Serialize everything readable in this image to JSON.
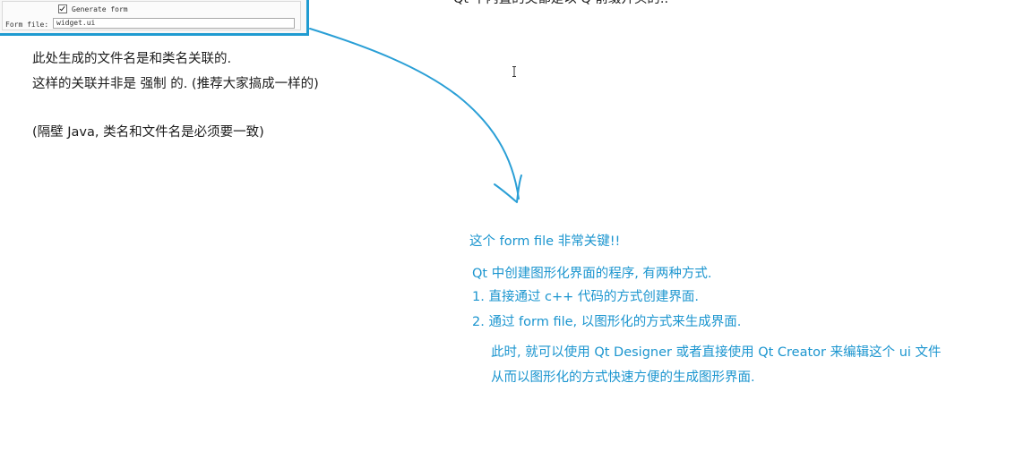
{
  "wizard": {
    "generate_form_label": "Generate form",
    "form_file_label": "Form file:",
    "form_file_value": "widget.ui"
  },
  "top_cut_text": "Qt 中内置的类都是以 Q 前缀开头的..",
  "notes_left": [
    "此处生成的文件名是和类名关联的.",
    "这样的关联并非是 强制 的. (推荐大家搞成一样的)",
    "(隔壁 Java, 类名和文件名是必须要一致)"
  ],
  "notes_blue": {
    "headline": "这个 form file 非常关键!!",
    "intro": "Qt 中创建图形化界面的程序, 有两种方式.",
    "item1": "1. 直接通过 c++ 代码的方式创建界面.",
    "item2": "2. 通过 form file, 以图形化的方式来生成界面.",
    "sub1": "此时, 就可以使用 Qt Designer 或者直接使用 Qt Creator 来编辑这个 ui 文件",
    "sub2": "从而以图形化的方式快速方便的生成图形界面."
  },
  "colors": {
    "highlight": "#1f9bd1",
    "blue_text": "#1b95cf",
    "arrow": "#2a9fd6"
  },
  "icons": {
    "cursor": "text-cursor-icon",
    "arrow": "hand-drawn-arrow"
  }
}
